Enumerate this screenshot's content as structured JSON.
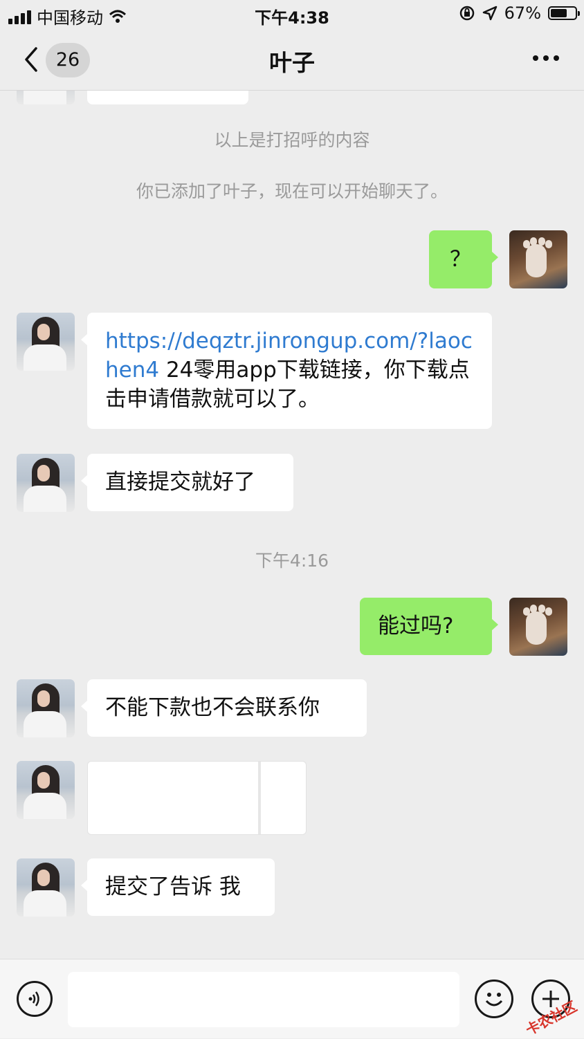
{
  "status_bar": {
    "carrier": "中国移动",
    "time": "下午4:38",
    "battery": "67%",
    "battery_level": 0.67
  },
  "nav": {
    "back_badge": "26",
    "title": "叶子"
  },
  "chat": {
    "system_messages": [
      "以上是打招呼的内容",
      "你已添加了叶子，现在可以开始聊天了。"
    ],
    "timestamps": [
      "下午4:16"
    ],
    "messages": [
      {
        "side": "right",
        "text": "？"
      },
      {
        "side": "left",
        "link": "https://deqztr.jinrongup.com/?laochen4",
        "text": " 24零用app下载链接，你下载点击申请借款就可以了。"
      },
      {
        "side": "left",
        "text": "直接提交就好了"
      },
      {
        "side": "right",
        "text": "能过吗?"
      },
      {
        "side": "left",
        "text": "不能下款也不会联系你"
      },
      {
        "side": "left",
        "type": "image"
      },
      {
        "side": "left",
        "text": "提交了告诉 我"
      }
    ]
  },
  "input_bar": {
    "voice_icon": "voice-icon",
    "emoji_icon": "emoji-icon",
    "add_icon": "add-icon"
  },
  "watermark": "卡农社区",
  "colors": {
    "my_bubble": "#95ec69",
    "their_bubble": "#ffffff",
    "link": "#2f7bd0",
    "background": "#ededed"
  }
}
